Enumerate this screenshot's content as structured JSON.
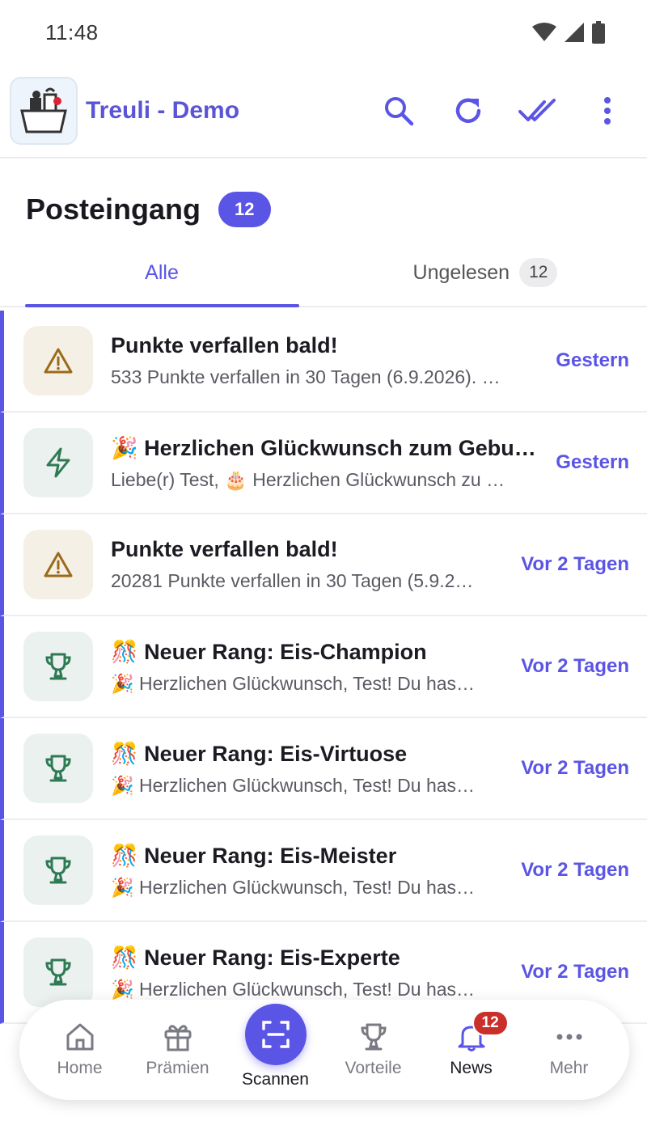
{
  "statusbar": {
    "time": "11:48"
  },
  "app": {
    "title": "Treuli - Demo"
  },
  "appbar": {
    "icons": [
      "search-icon",
      "refresh-icon",
      "mark-all-read-icon",
      "more-vert-icon"
    ]
  },
  "heading": {
    "title": "Posteingang",
    "count": "12"
  },
  "tabs": [
    {
      "label": "Alle"
    },
    {
      "label": "Ungelesen",
      "count": "12"
    }
  ],
  "messages": [
    {
      "icon": "warning-icon",
      "title": "Punkte verfallen bald!",
      "preview": "533 Punkte verfallen in 30 Tagen (6.9.2026). …",
      "time": "Gestern"
    },
    {
      "icon": "lightning-icon",
      "title": "🎉 Herzlichen Glückwunsch zum Gebu…",
      "preview": "Liebe(r) Test, 🎂 Herzlichen Glückwunsch zu …",
      "time": "Gestern"
    },
    {
      "icon": "warning-icon",
      "title": "Punkte verfallen bald!",
      "preview": "20281 Punkte verfallen in 30 Tagen (5.9.2…",
      "time": "Vor 2 Tagen"
    },
    {
      "icon": "trophy-icon",
      "title": "🎊 Neuer Rang: Eis-Champion",
      "preview": "🎉 Herzlichen Glückwunsch, Test! Du has…",
      "time": "Vor 2 Tagen"
    },
    {
      "icon": "trophy-icon",
      "title": "🎊 Neuer Rang: Eis-Virtuose",
      "preview": "🎉 Herzlichen Glückwunsch, Test! Du has…",
      "time": "Vor 2 Tagen"
    },
    {
      "icon": "trophy-icon",
      "title": "🎊 Neuer Rang: Eis-Meister",
      "preview": "🎉 Herzlichen Glückwunsch, Test! Du has…",
      "time": "Vor 2 Tagen"
    },
    {
      "icon": "trophy-icon",
      "title": "🎊 Neuer Rang: Eis-Experte",
      "preview": "🎉 Herzlichen Glückwunsch, Test! Du has…",
      "time": "Vor 2 Tagen"
    }
  ],
  "nav": {
    "home": "Home",
    "rewards": "Prämien",
    "scan": "Scannen",
    "benefits": "Vorteile",
    "news": "News",
    "news_badge": "12",
    "more": "Mehr"
  },
  "colors": {
    "accent": "#5b55e6",
    "badge": "#c9302c",
    "warning": "#9a6a1a",
    "success": "#2f7a55"
  }
}
